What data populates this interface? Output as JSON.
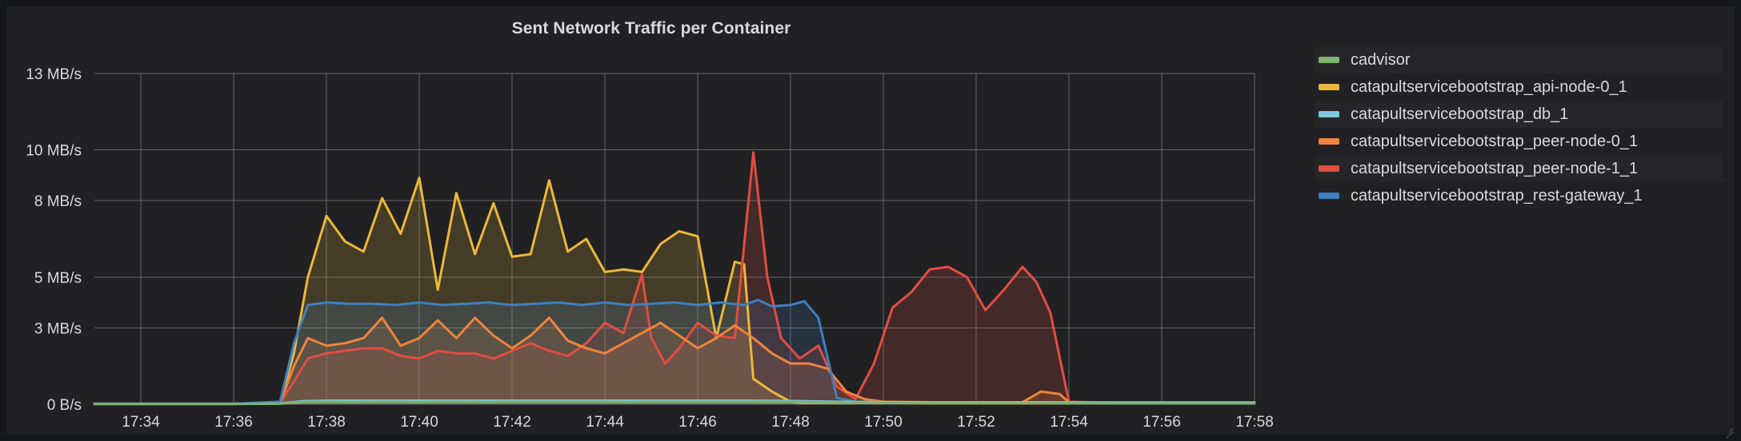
{
  "panel": {
    "title": "Sent Network Traffic per Container",
    "background": "#212124",
    "page_background": "#161719"
  },
  "legend": {
    "position": "right",
    "items": [
      {
        "label": "cadvisor",
        "color": "#7EB26D"
      },
      {
        "label": "catapultservicebootstrap_api-node-0_1",
        "color": "#EAB839"
      },
      {
        "label": "catapultservicebootstrap_db_1",
        "color": "#7FC9DD"
      },
      {
        "label": "catapultservicebootstrap_peer-node-0_1",
        "color": "#EF843C"
      },
      {
        "label": "catapultservicebootstrap_peer-node-1_1",
        "color": "#E24D42"
      },
      {
        "label": "catapultservicebootstrap_rest-gateway_1",
        "color": "#3E7FC1"
      }
    ]
  },
  "chart_data": {
    "type": "area",
    "title": "Sent Network Traffic per Container",
    "xlabel": "",
    "ylabel": "",
    "grid": true,
    "legend_position": "right",
    "y_unit": "MB/s",
    "ylim": [
      0,
      13
    ],
    "y_ticks": [
      0,
      3,
      5,
      8,
      10,
      13
    ],
    "y_tick_labels": [
      "0 B/s",
      "3 MB/s",
      "5 MB/s",
      "8 MB/s",
      "10 MB/s",
      "13 MB/s"
    ],
    "x_ticks": [
      "17:34",
      "17:36",
      "17:38",
      "17:40",
      "17:42",
      "17:44",
      "17:46",
      "17:48",
      "17:50",
      "17:52",
      "17:54",
      "17:56",
      "17:58"
    ],
    "x_range": [
      "17:33",
      "17:58"
    ],
    "x_minutes": [
      33,
      58
    ],
    "series": [
      {
        "name": "cadvisor",
        "color": "#7EB26D",
        "x": [
          33,
          34,
          35,
          36,
          37,
          37.5,
          38,
          38.5,
          39,
          39.5,
          40,
          40.5,
          41,
          41.5,
          42,
          42.5,
          43,
          43.5,
          44,
          44.5,
          45,
          45.5,
          46,
          46.5,
          47,
          47.5,
          48,
          48.5,
          49,
          50,
          51,
          52,
          53,
          54,
          55,
          56,
          57,
          58
        ],
        "values": [
          0.01,
          0.01,
          0.01,
          0.01,
          0.02,
          0.09,
          0.1,
          0.09,
          0.1,
          0.1,
          0.09,
          0.1,
          0.1,
          0.09,
          0.1,
          0.1,
          0.1,
          0.1,
          0.1,
          0.09,
          0.1,
          0.1,
          0.1,
          0.1,
          0.1,
          0.1,
          0.09,
          0.08,
          0.06,
          0.05,
          0.05,
          0.05,
          0.05,
          0.04,
          0.03,
          0.03,
          0.03,
          0.03
        ]
      },
      {
        "name": "catapultservicebootstrap_api-node-0_1",
        "color": "#EAB839",
        "x": [
          33,
          34,
          35,
          36,
          37,
          37.3,
          37.6,
          38,
          38.4,
          38.8,
          39.2,
          39.6,
          40,
          40.4,
          40.8,
          41.2,
          41.6,
          42,
          42.4,
          42.8,
          43.2,
          43.6,
          44,
          44.4,
          44.8,
          45.2,
          45.6,
          46,
          46.4,
          46.8,
          47,
          47.2,
          47.6,
          48,
          48.2,
          48.6,
          49,
          49.3,
          49.6,
          50,
          51,
          52,
          53,
          54,
          55,
          56,
          57,
          58
        ],
        "values": [
          0.02,
          0.02,
          0.02,
          0.02,
          0.05,
          2.0,
          5.0,
          7.4,
          6.4,
          6.0,
          8.1,
          6.7,
          8.9,
          4.5,
          8.3,
          5.9,
          7.9,
          5.8,
          5.9,
          8.8,
          6.0,
          6.5,
          5.2,
          5.3,
          5.2,
          6.3,
          6.8,
          6.6,
          2.6,
          5.6,
          5.5,
          1.0,
          0.5,
          0.1,
          0.06,
          0.05,
          0.05,
          0.05,
          0.05,
          0.05,
          0.04,
          0.04,
          0.04,
          0.04,
          0.04,
          0.04,
          0.04,
          0.04
        ]
      },
      {
        "name": "catapultservicebootstrap_db_1",
        "color": "#7FC9DD",
        "x": [
          33,
          34,
          35,
          36,
          37,
          37.5,
          38,
          39,
          40,
          41,
          42,
          43,
          44,
          45,
          46,
          47,
          48,
          49,
          50,
          51,
          52,
          53,
          54,
          55,
          56,
          57,
          58
        ],
        "values": [
          0.01,
          0.01,
          0.01,
          0.01,
          0.03,
          0.12,
          0.14,
          0.14,
          0.14,
          0.14,
          0.14,
          0.14,
          0.14,
          0.14,
          0.14,
          0.14,
          0.13,
          0.1,
          0.08,
          0.08,
          0.08,
          0.08,
          0.07,
          0.06,
          0.06,
          0.06,
          0.06
        ]
      },
      {
        "name": "catapultservicebootstrap_peer-node-0_1",
        "color": "#EF843C",
        "x": [
          33,
          34,
          35,
          36,
          37,
          37.3,
          37.6,
          38,
          38.4,
          38.8,
          39.2,
          39.6,
          40,
          40.4,
          40.8,
          41.2,
          41.6,
          42,
          42.4,
          42.8,
          43.2,
          43.6,
          44,
          44.4,
          44.8,
          45.2,
          45.6,
          46,
          46.4,
          46.8,
          47.2,
          47.6,
          48,
          48.4,
          48.8,
          49.2,
          49.6,
          50,
          51,
          52,
          53,
          53.4,
          53.8,
          54,
          55,
          56,
          57,
          58
        ],
        "values": [
          0.01,
          0.01,
          0.01,
          0.01,
          0.05,
          1.5,
          2.6,
          2.3,
          2.4,
          2.6,
          3.4,
          2.3,
          2.6,
          3.3,
          2.6,
          3.4,
          2.7,
          2.2,
          2.7,
          3.4,
          2.5,
          2.2,
          2.0,
          2.4,
          2.8,
          3.2,
          2.7,
          2.2,
          2.6,
          3.1,
          2.6,
          2.0,
          1.6,
          1.6,
          1.4,
          0.5,
          0.2,
          0.1,
          0.08,
          0.08,
          0.08,
          0.5,
          0.4,
          0.08,
          0.07,
          0.07,
          0.07,
          0.07
        ]
      },
      {
        "name": "catapultservicebootstrap_peer-node-1_1",
        "color": "#E24D42",
        "x": [
          33,
          34,
          35,
          36,
          37,
          37.3,
          37.6,
          38,
          38.4,
          38.8,
          39.2,
          39.6,
          40,
          40.4,
          40.8,
          41.2,
          41.6,
          42,
          42.4,
          42.8,
          43.2,
          43.6,
          44,
          44.4,
          44.8,
          45,
          45.3,
          45.6,
          46,
          46.4,
          46.8,
          47.2,
          47.5,
          47.8,
          48.2,
          48.6,
          49,
          49.4,
          49.8,
          50.2,
          50.6,
          51,
          51.4,
          51.8,
          52.2,
          52.6,
          53,
          53.3,
          53.6,
          54,
          55,
          56,
          57,
          58
        ],
        "values": [
          0.01,
          0.01,
          0.01,
          0.01,
          0.05,
          0.9,
          1.8,
          2.0,
          2.1,
          2.2,
          2.2,
          1.9,
          1.8,
          2.1,
          2.0,
          2.0,
          1.8,
          2.1,
          2.4,
          2.1,
          1.9,
          2.4,
          3.2,
          2.8,
          5.1,
          2.6,
          1.6,
          2.2,
          3.2,
          2.7,
          2.6,
          9.9,
          5.0,
          2.6,
          1.8,
          2.3,
          0.7,
          0.2,
          1.6,
          3.8,
          4.4,
          5.3,
          5.4,
          5.0,
          3.7,
          4.5,
          5.4,
          4.8,
          3.6,
          0.1,
          0.05,
          0.05,
          0.05,
          0.05
        ]
      },
      {
        "name": "catapultservicebootstrap_rest-gateway_1",
        "color": "#3E7FC1",
        "x": [
          33,
          34,
          35,
          36,
          37,
          37.3,
          37.6,
          38,
          38.5,
          39,
          39.5,
          40,
          40.5,
          41,
          41.5,
          42,
          42.5,
          43,
          43.5,
          44,
          44.5,
          45,
          45.5,
          46,
          46.5,
          47,
          47.3,
          47.6,
          48,
          48.3,
          48.6,
          49,
          49.4,
          50,
          51,
          52,
          53,
          54,
          55,
          56,
          57,
          58
        ],
        "values": [
          0.02,
          0.02,
          0.02,
          0.02,
          0.1,
          2.4,
          3.9,
          4.0,
          3.95,
          3.95,
          3.9,
          4.0,
          3.9,
          3.95,
          4.0,
          3.9,
          3.95,
          4.0,
          3.9,
          4.0,
          3.9,
          3.95,
          4.0,
          3.9,
          4.0,
          3.9,
          4.1,
          3.85,
          3.9,
          4.05,
          3.4,
          0.25,
          0.1,
          0.08,
          0.08,
          0.08,
          0.08,
          0.08,
          0.08,
          0.08,
          0.08,
          0.08
        ]
      }
    ]
  },
  "axis": {
    "grid_color": "#65666a",
    "label_color": "#d8d9da"
  }
}
